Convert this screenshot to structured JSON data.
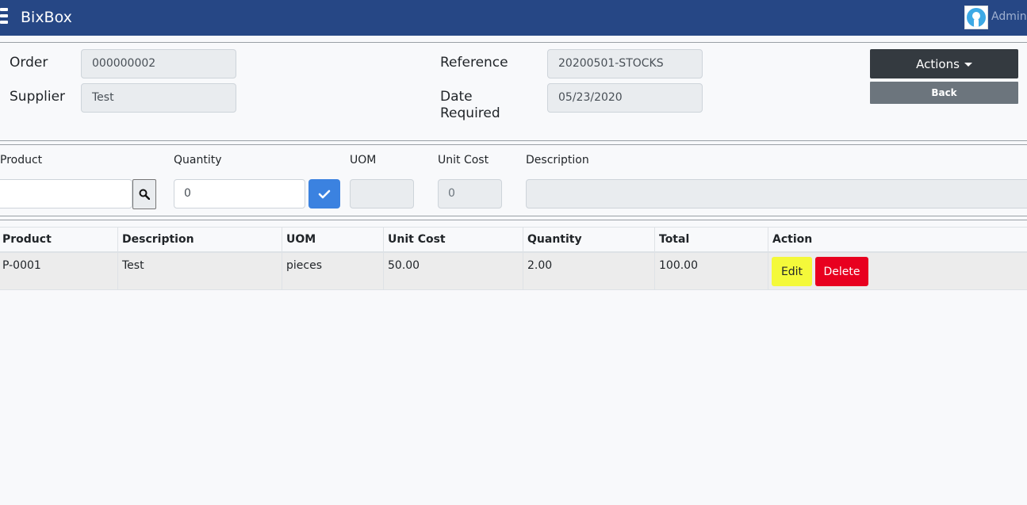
{
  "app": {
    "brand": "BixBox",
    "user_name": "Admin"
  },
  "header_form": {
    "order_label": "Order",
    "order_value": "000000002",
    "supplier_label": "Supplier",
    "supplier_value": "Test",
    "reference_label": "Reference",
    "reference_value": "20200501-STOCKS",
    "date_label_line1": "Date",
    "date_label_line2": "Required",
    "date_value": "05/23/2020"
  },
  "buttons": {
    "actions": "Actions",
    "back": "Back",
    "edit": "Edit",
    "delete": "Delete"
  },
  "line_entry": {
    "product_label": "Product",
    "product_value": "",
    "quantity_label": "Quantity",
    "quantity_value": "0",
    "uom_label": "UOM",
    "uom_value": "",
    "unit_cost_label": "Unit Cost",
    "unit_cost_value": "0",
    "description_label": "Description",
    "description_value": ""
  },
  "table": {
    "columns": [
      "Product",
      "Description",
      "UOM",
      "Unit Cost",
      "Quantity",
      "Total",
      "Action"
    ],
    "rows": [
      {
        "product": "P-0001",
        "description": "Test",
        "uom": "pieces",
        "unit_cost": "50.00",
        "quantity": "2.00",
        "total": "100.00"
      }
    ]
  },
  "icons": {
    "menu": "hamburger-icon",
    "search": "search-icon",
    "confirm": "check-icon",
    "avatar": "user-avatar-icon"
  },
  "colors": {
    "navbar": "#264785",
    "actions_button": "#343a40",
    "back_button": "#6c757d",
    "confirm_button": "#3b82e0",
    "edit_button": "#f4f93a",
    "delete_button": "#e8001f"
  }
}
